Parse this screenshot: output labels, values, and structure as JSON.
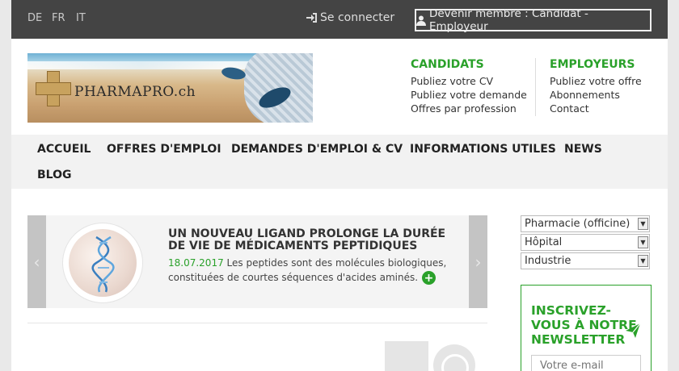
{
  "topbar": {
    "languages": [
      "DE",
      "FR",
      "IT"
    ],
    "login_label": "Se connecter",
    "member_label": "Devenir membre : Candidat - Employeur"
  },
  "header": {
    "logo_text": "PHARMAPRO.ch",
    "candidats": {
      "title": "CANDIDATS",
      "links": [
        "Publiez votre CV",
        "Publiez votre demande",
        "Offres par profession"
      ]
    },
    "employeurs": {
      "title": "EMPLOYEURS",
      "links": [
        "Publiez votre offre",
        "Abonnements",
        "Contact"
      ]
    }
  },
  "nav": {
    "items": [
      "ACCUEIL",
      "OFFRES D'EMPLOI",
      "DEMANDES D'EMPLOI & CV",
      "INFORMATIONS UTILES",
      "NEWS",
      "BLOG"
    ]
  },
  "slider": {
    "title": "UN NOUVEAU LIGAND PROLONGE LA DURÉE DE VIE DE MÉDICAMENTS PEPTIDIQUES",
    "date": "18.07.2017",
    "text": "Les peptides sont des molécules biologiques, constituées de courtes séquences d'acides aminés.",
    "prev_glyph": "‹",
    "next_glyph": "›",
    "more_glyph": "+"
  },
  "sidebar": {
    "selects": [
      "Pharmacie (officine)",
      "Hôpital",
      "Industrie"
    ],
    "newsletter_title": "INSCRIVEZ-VOUS À NOTRE NEWSLETTER",
    "email_placeholder": "Votre e-mail"
  },
  "colors": {
    "accent": "#2aa12a",
    "topbar": "#444444",
    "nav_bg": "#f2f2f2"
  }
}
